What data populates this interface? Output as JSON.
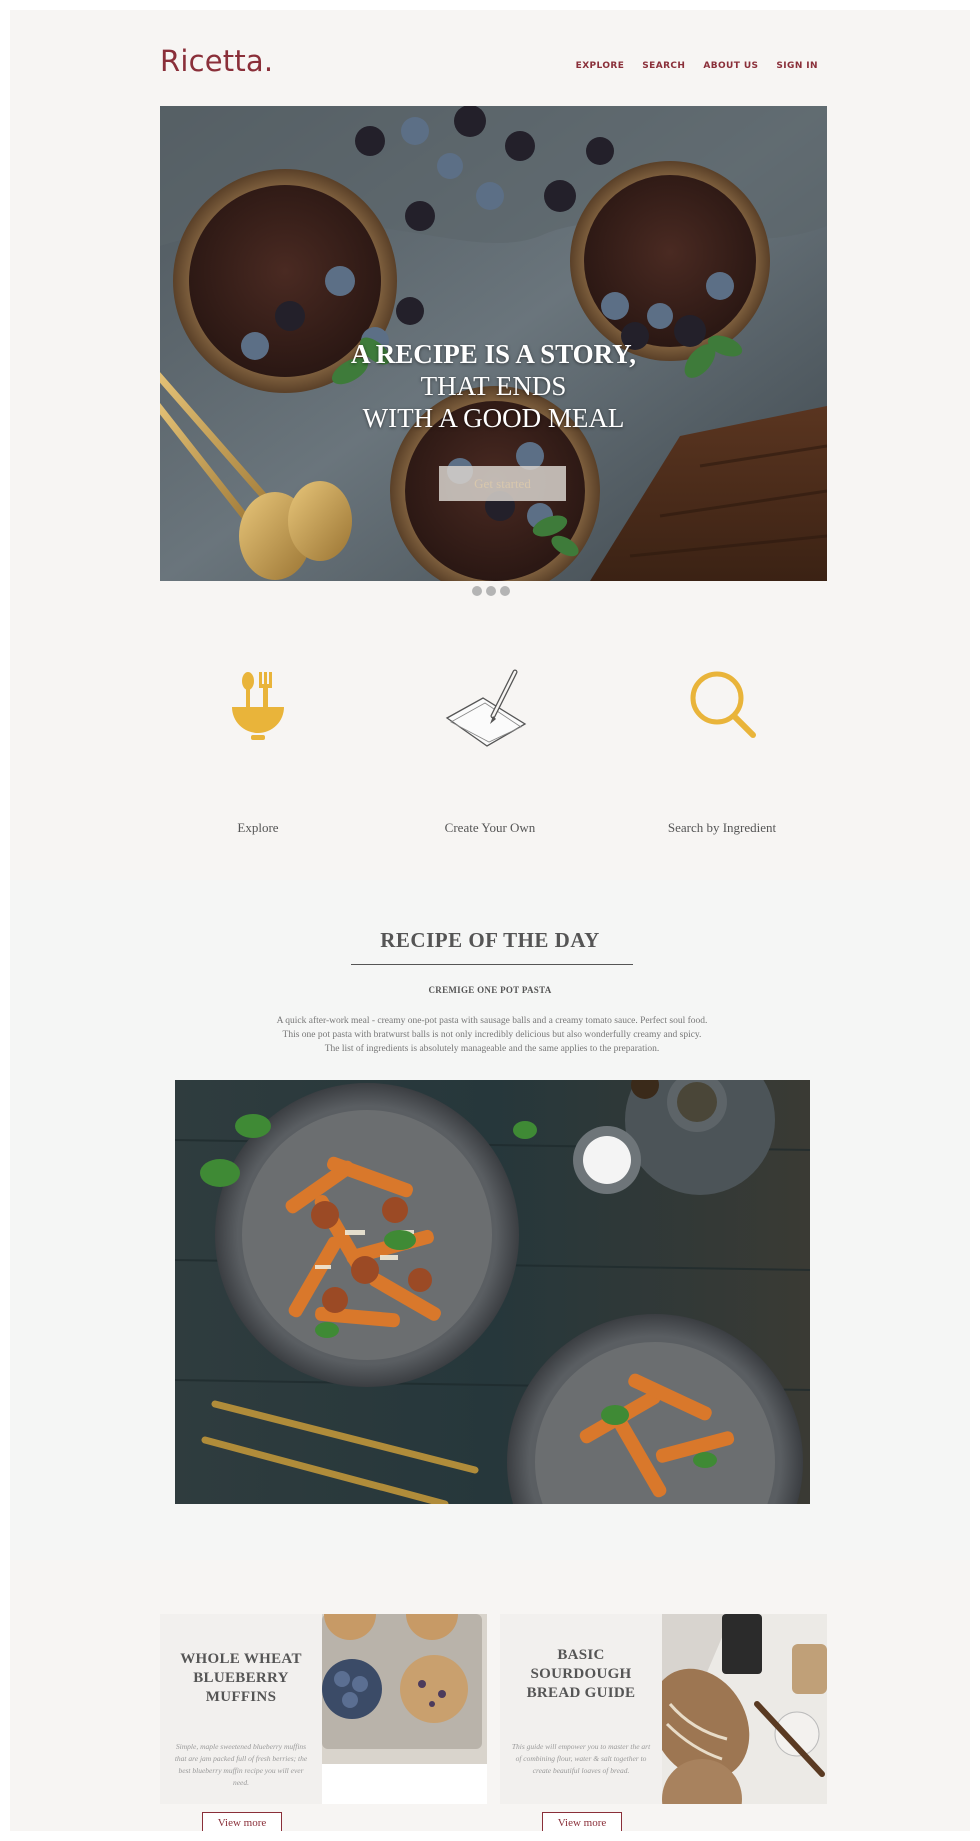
{
  "header": {
    "logo": "Ricetta.",
    "nav": [
      "EXPLORE",
      "SEARCH",
      "ABOUT US",
      "SIGN IN"
    ]
  },
  "hero": {
    "lines": [
      "A RECIPE IS A STORY,",
      "THAT ENDS",
      "WITH A GOOD MEAL"
    ],
    "button_label": "Get started",
    "slides": 3,
    "active_slide": 1
  },
  "features": [
    {
      "label": "Explore",
      "icon": "bowl-fork-spoon-icon"
    },
    {
      "label": "Create Your Own",
      "icon": "pen-paper-icon"
    },
    {
      "label": "Search by Ingredient",
      "icon": "magnifier-icon"
    }
  ],
  "recipe_of_the_day": {
    "title": "RECIPE OF THE DAY",
    "subtitle": "CREMIGE ONE POT PASTA",
    "description": [
      "A quick after-work meal - creamy one-pot pasta with sausage balls and a creamy tomato sauce. Perfect soul food.",
      "This one pot pasta with bratwurst balls is not only incredibly delicious but also wonderfully creamy and spicy.",
      "The list of ingredients is absolutely manageable and the same applies to the preparation."
    ]
  },
  "cards": [
    {
      "title_lines": [
        "WHOLE WHEAT",
        "BLUEBERRY",
        "MUFFINS"
      ],
      "description": "Simple, maple sweetened blueberry muffins that are jam packed full of fresh berries; the best blueberry muffin recipe you will ever need.",
      "button_label": "View more"
    },
    {
      "title_lines": [
        "BASIC",
        "SOURDOUGH",
        "BREAD GUIDE"
      ],
      "description": "This guide will empower you to master the art of combining flour, water & salt together to create beautiful loaves of bread.",
      "button_label": "View more"
    }
  ],
  "colors": {
    "brand": "#8a2f39",
    "accent_yellow": "#e9b43a",
    "page_bg": "#f7f5f3",
    "text_gray": "#555555"
  }
}
